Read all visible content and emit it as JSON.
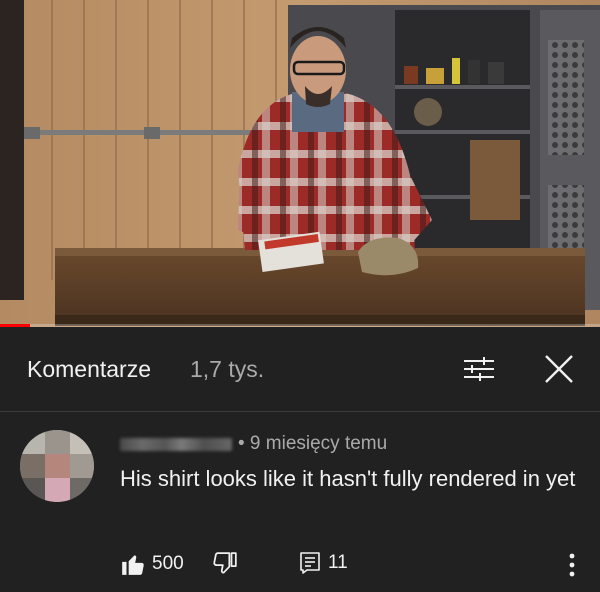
{
  "video": {
    "progress": 0.05,
    "progress_color": "#ff0000"
  },
  "comments_panel": {
    "title": "Komentarze",
    "count": "1,7 tys.",
    "sort_icon": "sort-filter-icon",
    "close_icon": "close-icon"
  },
  "comment": {
    "author": "",
    "time": "• 9 miesięcy temu",
    "text": "His shirt looks like it hasn't fully rendered in yet",
    "likes": "500",
    "replies": "11",
    "like_icon": "thumbs-up-icon",
    "dislike_icon": "thumbs-down-icon",
    "reply_icon": "reply-icon",
    "menu_icon": "more-vertical-icon"
  }
}
